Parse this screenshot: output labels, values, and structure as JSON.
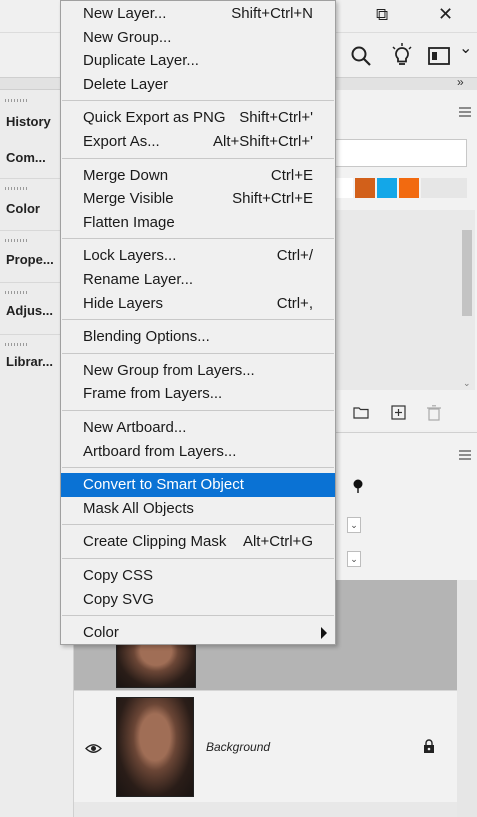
{
  "window": {
    "restore_glyph": "⧉",
    "close_glyph": "✕"
  },
  "toolbar": {
    "search_glyph": "🔍",
    "chevron_glyph": "⌄"
  },
  "left_dock": {
    "collapse_glyph": "»",
    "items": [
      {
        "label": "History"
      },
      {
        "label": "Com..."
      },
      {
        "label": "Color"
      },
      {
        "label": "Prope..."
      },
      {
        "label": "Adjus..."
      },
      {
        "label": "Librar..."
      }
    ]
  },
  "swatches": {
    "colors": [
      "#ffffff",
      "#d2601a",
      "#13a7e8",
      "#f26a10"
    ]
  },
  "layers": {
    "background_layer_name": "Background",
    "visibility_glyph": "👁",
    "lock_glyph": "🔒"
  },
  "context_menu": {
    "groups": [
      [
        {
          "label": "New Layer...",
          "shortcut": "Shift+Ctrl+N"
        },
        {
          "label": "New Group...",
          "shortcut": ""
        },
        {
          "label": "Duplicate Layer...",
          "shortcut": ""
        },
        {
          "label": "Delete Layer",
          "shortcut": ""
        }
      ],
      [
        {
          "label": "Quick Export as PNG",
          "shortcut": "Shift+Ctrl+'"
        },
        {
          "label": "Export As...",
          "shortcut": "Alt+Shift+Ctrl+'"
        }
      ],
      [
        {
          "label": "Merge Down",
          "shortcut": "Ctrl+E"
        },
        {
          "label": "Merge Visible",
          "shortcut": "Shift+Ctrl+E"
        },
        {
          "label": "Flatten Image",
          "shortcut": ""
        }
      ],
      [
        {
          "label": "Lock Layers...",
          "shortcut": "Ctrl+/"
        },
        {
          "label": "Rename Layer...",
          "shortcut": ""
        },
        {
          "label": "Hide Layers",
          "shortcut": "Ctrl+,"
        }
      ],
      [
        {
          "label": "Blending Options...",
          "shortcut": ""
        }
      ],
      [
        {
          "label": "New Group from Layers...",
          "shortcut": ""
        },
        {
          "label": "Frame from Layers...",
          "shortcut": ""
        }
      ],
      [
        {
          "label": "New Artboard...",
          "shortcut": ""
        },
        {
          "label": "Artboard from Layers...",
          "shortcut": ""
        }
      ],
      [
        {
          "label": "Convert to Smart Object",
          "shortcut": "",
          "highlighted": true
        },
        {
          "label": "Mask All Objects",
          "shortcut": ""
        }
      ],
      [
        {
          "label": "Create Clipping Mask",
          "shortcut": "Alt+Ctrl+G"
        }
      ],
      [
        {
          "label": "Copy CSS",
          "shortcut": ""
        },
        {
          "label": "Copy SVG",
          "shortcut": ""
        }
      ],
      [
        {
          "label": "Color",
          "shortcut": "",
          "submenu": true
        }
      ]
    ]
  }
}
